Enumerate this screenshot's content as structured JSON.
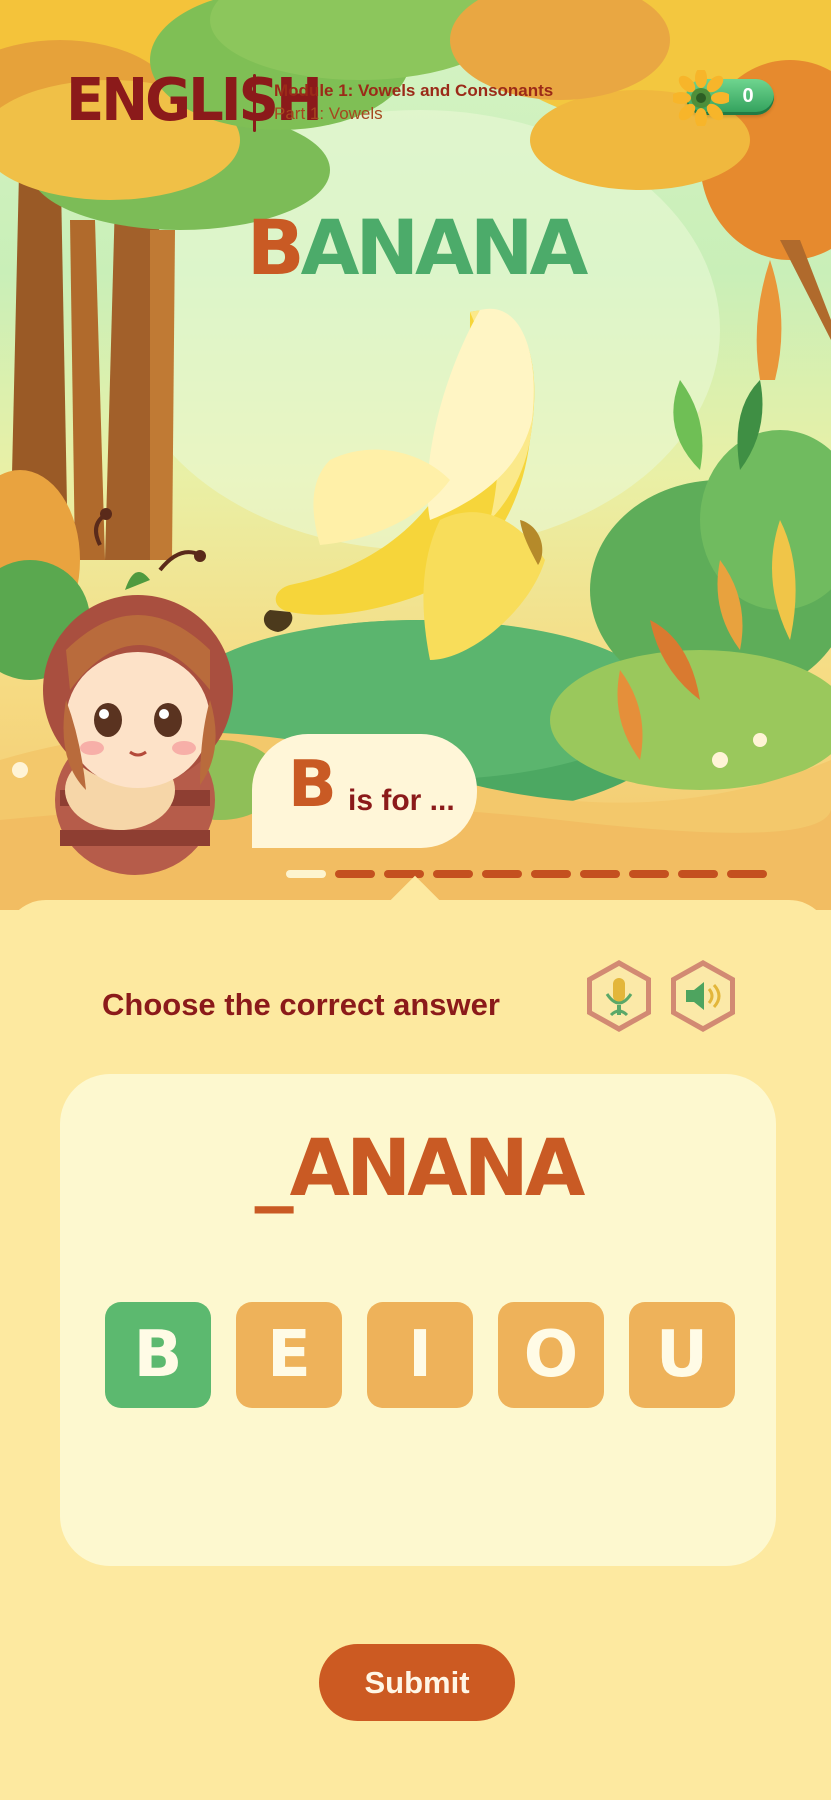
{
  "header": {
    "subject": "ENGLISH",
    "module": "Module 1: Vowels and Consonants",
    "part": "Part 1: Vowels",
    "coins": "0"
  },
  "word": {
    "first_letter": "B",
    "rest": "ANANA"
  },
  "bubble": {
    "letter": "B",
    "text": "is for ..."
  },
  "progress": {
    "total_steps": 10,
    "current_step": 1,
    "colors": {
      "done": "#fdf4cf",
      "todo": "#c4501f"
    }
  },
  "question": {
    "prompt": "Choose the correct answer",
    "blank_word": "_ANANA",
    "icons": [
      "microphone-icon",
      "speaker-icon"
    ]
  },
  "options": {
    "letters": [
      "B",
      "E",
      "I",
      "O",
      "U"
    ],
    "selected": "B"
  },
  "submit_label": "Submit",
  "colors": {
    "accent": "#cc5a22",
    "title_dark": "#8b1a1a",
    "correct_green": "#5cb96f",
    "option_orange": "#eeb25a",
    "panel_bg": "#fde9a0",
    "card_bg": "#fdf8cf"
  }
}
